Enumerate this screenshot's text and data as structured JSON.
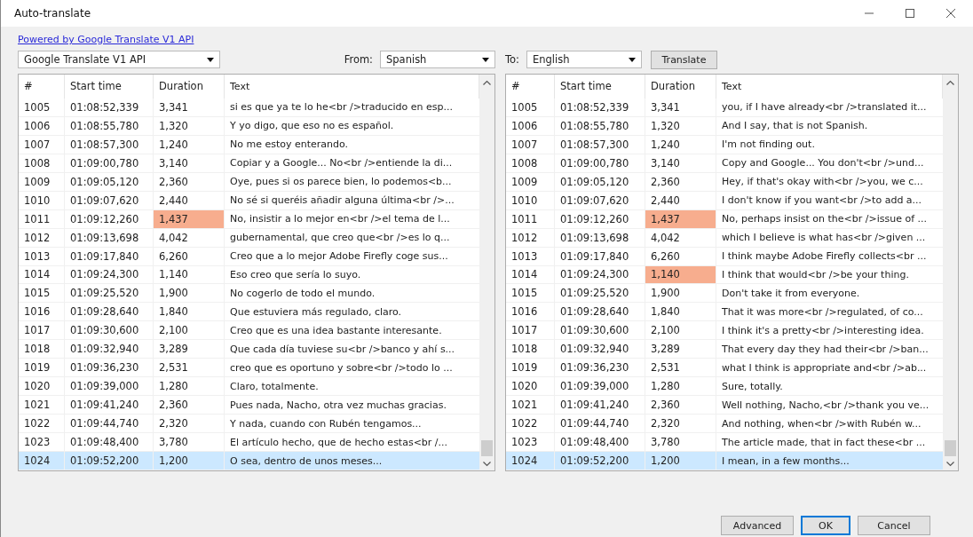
{
  "window": {
    "title": "Auto-translate"
  },
  "link": "Powered by Google Translate V1 API",
  "engine": {
    "value": "Google Translate V1 API"
  },
  "from": {
    "label": "From:",
    "value": "Spanish"
  },
  "to": {
    "label": "To:",
    "value": "English"
  },
  "translate_button": "Translate",
  "tables": [
    {
      "columns": [
        "#",
        "Start time",
        "Duration",
        "Text"
      ],
      "rows": [
        {
          "number": "1005",
          "start": "01:08:52,339",
          "duration": "3,341",
          "text": "si es que ya te lo he<br />traducido en esp...",
          "flagged": false,
          "selected": false
        },
        {
          "number": "1006",
          "start": "01:08:55,780",
          "duration": "1,320",
          "text": "Y yo digo, que eso no es español.",
          "flagged": false,
          "selected": false
        },
        {
          "number": "1007",
          "start": "01:08:57,300",
          "duration": "1,240",
          "text": "No me estoy enterando.",
          "flagged": false,
          "selected": false
        },
        {
          "number": "1008",
          "start": "01:09:00,780",
          "duration": "3,140",
          "text": "Copiar y a Google... No<br />entiende la di...",
          "flagged": false,
          "selected": false
        },
        {
          "number": "1009",
          "start": "01:09:05,120",
          "duration": "2,360",
          "text": "Oye, pues si os parece bien, lo podemos<b...",
          "flagged": false,
          "selected": false
        },
        {
          "number": "1010",
          "start": "01:09:07,620",
          "duration": "2,440",
          "text": "No sé si queréis añadir alguna última<br />...",
          "flagged": false,
          "selected": false
        },
        {
          "number": "1011",
          "start": "01:09:12,260",
          "duration": "1,437",
          "text": "No, insistir a lo mejor en<br />el tema de l...",
          "flagged": true,
          "selected": false
        },
        {
          "number": "1012",
          "start": "01:09:13,698",
          "duration": "4,042",
          "text": "gubernamental, que creo que<br />es lo q...",
          "flagged": false,
          "selected": false
        },
        {
          "number": "1013",
          "start": "01:09:17,840",
          "duration": "6,260",
          "text": "Creo que a lo mejor Adobe Firefly coge sus...",
          "flagged": false,
          "selected": false
        },
        {
          "number": "1014",
          "start": "01:09:24,300",
          "duration": "1,140",
          "text": "Eso creo que sería lo suyo.",
          "flagged": false,
          "selected": false
        },
        {
          "number": "1015",
          "start": "01:09:25,520",
          "duration": "1,900",
          "text": "No cogerlo de todo el mundo.",
          "flagged": false,
          "selected": false
        },
        {
          "number": "1016",
          "start": "01:09:28,640",
          "duration": "1,840",
          "text": "Que estuviera más regulado, claro.",
          "flagged": false,
          "selected": false
        },
        {
          "number": "1017",
          "start": "01:09:30,600",
          "duration": "2,100",
          "text": "Creo que es una idea bastante interesante.",
          "flagged": false,
          "selected": false
        },
        {
          "number": "1018",
          "start": "01:09:32,940",
          "duration": "3,289",
          "text": "Que cada día tuviese su<br />banco y ahí s...",
          "flagged": false,
          "selected": false
        },
        {
          "number": "1019",
          "start": "01:09:36,230",
          "duration": "2,531",
          "text": "creo que es oportuno y sobre<br />todo lo ...",
          "flagged": false,
          "selected": false
        },
        {
          "number": "1020",
          "start": "01:09:39,000",
          "duration": "1,280",
          "text": "Claro, totalmente.",
          "flagged": false,
          "selected": false
        },
        {
          "number": "1021",
          "start": "01:09:41,240",
          "duration": "2,360",
          "text": "Pues nada, Nacho, otra vez muchas gracias.",
          "flagged": false,
          "selected": false
        },
        {
          "number": "1022",
          "start": "01:09:44,740",
          "duration": "2,320",
          "text": "Y nada, cuando con Rubén tengamos...",
          "flagged": false,
          "selected": false
        },
        {
          "number": "1023",
          "start": "01:09:48,400",
          "duration": "3,780",
          "text": "El artículo hecho, que de hecho estas<br /...",
          "flagged": false,
          "selected": false
        },
        {
          "number": "1024",
          "start": "01:09:52,200",
          "duration": "1,200",
          "text": "O sea, dentro de unos meses...",
          "flagged": false,
          "selected": true
        }
      ]
    },
    {
      "columns": [
        "#",
        "Start time",
        "Duration",
        "Text"
      ],
      "rows": [
        {
          "number": "1005",
          "start": "01:08:52,339",
          "duration": "3,341",
          "text": "you, if I have already<br />translated it...",
          "flagged": false,
          "selected": false
        },
        {
          "number": "1006",
          "start": "01:08:55,780",
          "duration": "1,320",
          "text": "And I say, that is not Spanish.",
          "flagged": false,
          "selected": false
        },
        {
          "number": "1007",
          "start": "01:08:57,300",
          "duration": "1,240",
          "text": "I'm not finding out.",
          "flagged": false,
          "selected": false
        },
        {
          "number": "1008",
          "start": "01:09:00,780",
          "duration": "3,140",
          "text": "Copy and Google... You don't<br />und...",
          "flagged": false,
          "selected": false
        },
        {
          "number": "1009",
          "start": "01:09:05,120",
          "duration": "2,360",
          "text": "Hey, if that's okay with<br />you, we c...",
          "flagged": false,
          "selected": false
        },
        {
          "number": "1010",
          "start": "01:09:07,620",
          "duration": "2,440",
          "text": "I don't know if you want<br />to add a...",
          "flagged": false,
          "selected": false
        },
        {
          "number": "1011",
          "start": "01:09:12,260",
          "duration": "1,437",
          "text": "No, perhaps insist on the<br />issue of ...",
          "flagged": true,
          "selected": false
        },
        {
          "number": "1012",
          "start": "01:09:13,698",
          "duration": "4,042",
          "text": "which I believe is what has<br />given ...",
          "flagged": false,
          "selected": false
        },
        {
          "number": "1013",
          "start": "01:09:17,840",
          "duration": "6,260",
          "text": "I think maybe Adobe Firefly collects<br ...",
          "flagged": false,
          "selected": false
        },
        {
          "number": "1014",
          "start": "01:09:24,300",
          "duration": "1,140",
          "text": "I think that would<br />be your thing.",
          "flagged": true,
          "selected": false
        },
        {
          "number": "1015",
          "start": "01:09:25,520",
          "duration": "1,900",
          "text": "Don't take it from everyone.",
          "flagged": false,
          "selected": false
        },
        {
          "number": "1016",
          "start": "01:09:28,640",
          "duration": "1,840",
          "text": "That it was more<br />regulated, of co...",
          "flagged": false,
          "selected": false
        },
        {
          "number": "1017",
          "start": "01:09:30,600",
          "duration": "2,100",
          "text": "I think it's a pretty<br />interesting idea.",
          "flagged": false,
          "selected": false
        },
        {
          "number": "1018",
          "start": "01:09:32,940",
          "duration": "3,289",
          "text": "That every day they had their<br />ban...",
          "flagged": false,
          "selected": false
        },
        {
          "number": "1019",
          "start": "01:09:36,230",
          "duration": "2,531",
          "text": "what I think is appropriate and<br />ab...",
          "flagged": false,
          "selected": false
        },
        {
          "number": "1020",
          "start": "01:09:39,000",
          "duration": "1,280",
          "text": "Sure, totally.",
          "flagged": false,
          "selected": false
        },
        {
          "number": "1021",
          "start": "01:09:41,240",
          "duration": "2,360",
          "text": "Well nothing, Nacho,<br />thank you ve...",
          "flagged": false,
          "selected": false
        },
        {
          "number": "1022",
          "start": "01:09:44,740",
          "duration": "2,320",
          "text": "And nothing, when<br />with Rubén w...",
          "flagged": false,
          "selected": false
        },
        {
          "number": "1023",
          "start": "01:09:48,400",
          "duration": "3,780",
          "text": "The article made, that in fact these<br ...",
          "flagged": false,
          "selected": false
        },
        {
          "number": "1024",
          "start": "01:09:52,200",
          "duration": "1,200",
          "text": "I mean, in a few months...",
          "flagged": false,
          "selected": true
        }
      ]
    }
  ],
  "buttons": [
    {
      "label": "Advanced",
      "default": false
    },
    {
      "label": "OK",
      "default": true
    },
    {
      "label": "Cancel",
      "default": false
    }
  ]
}
